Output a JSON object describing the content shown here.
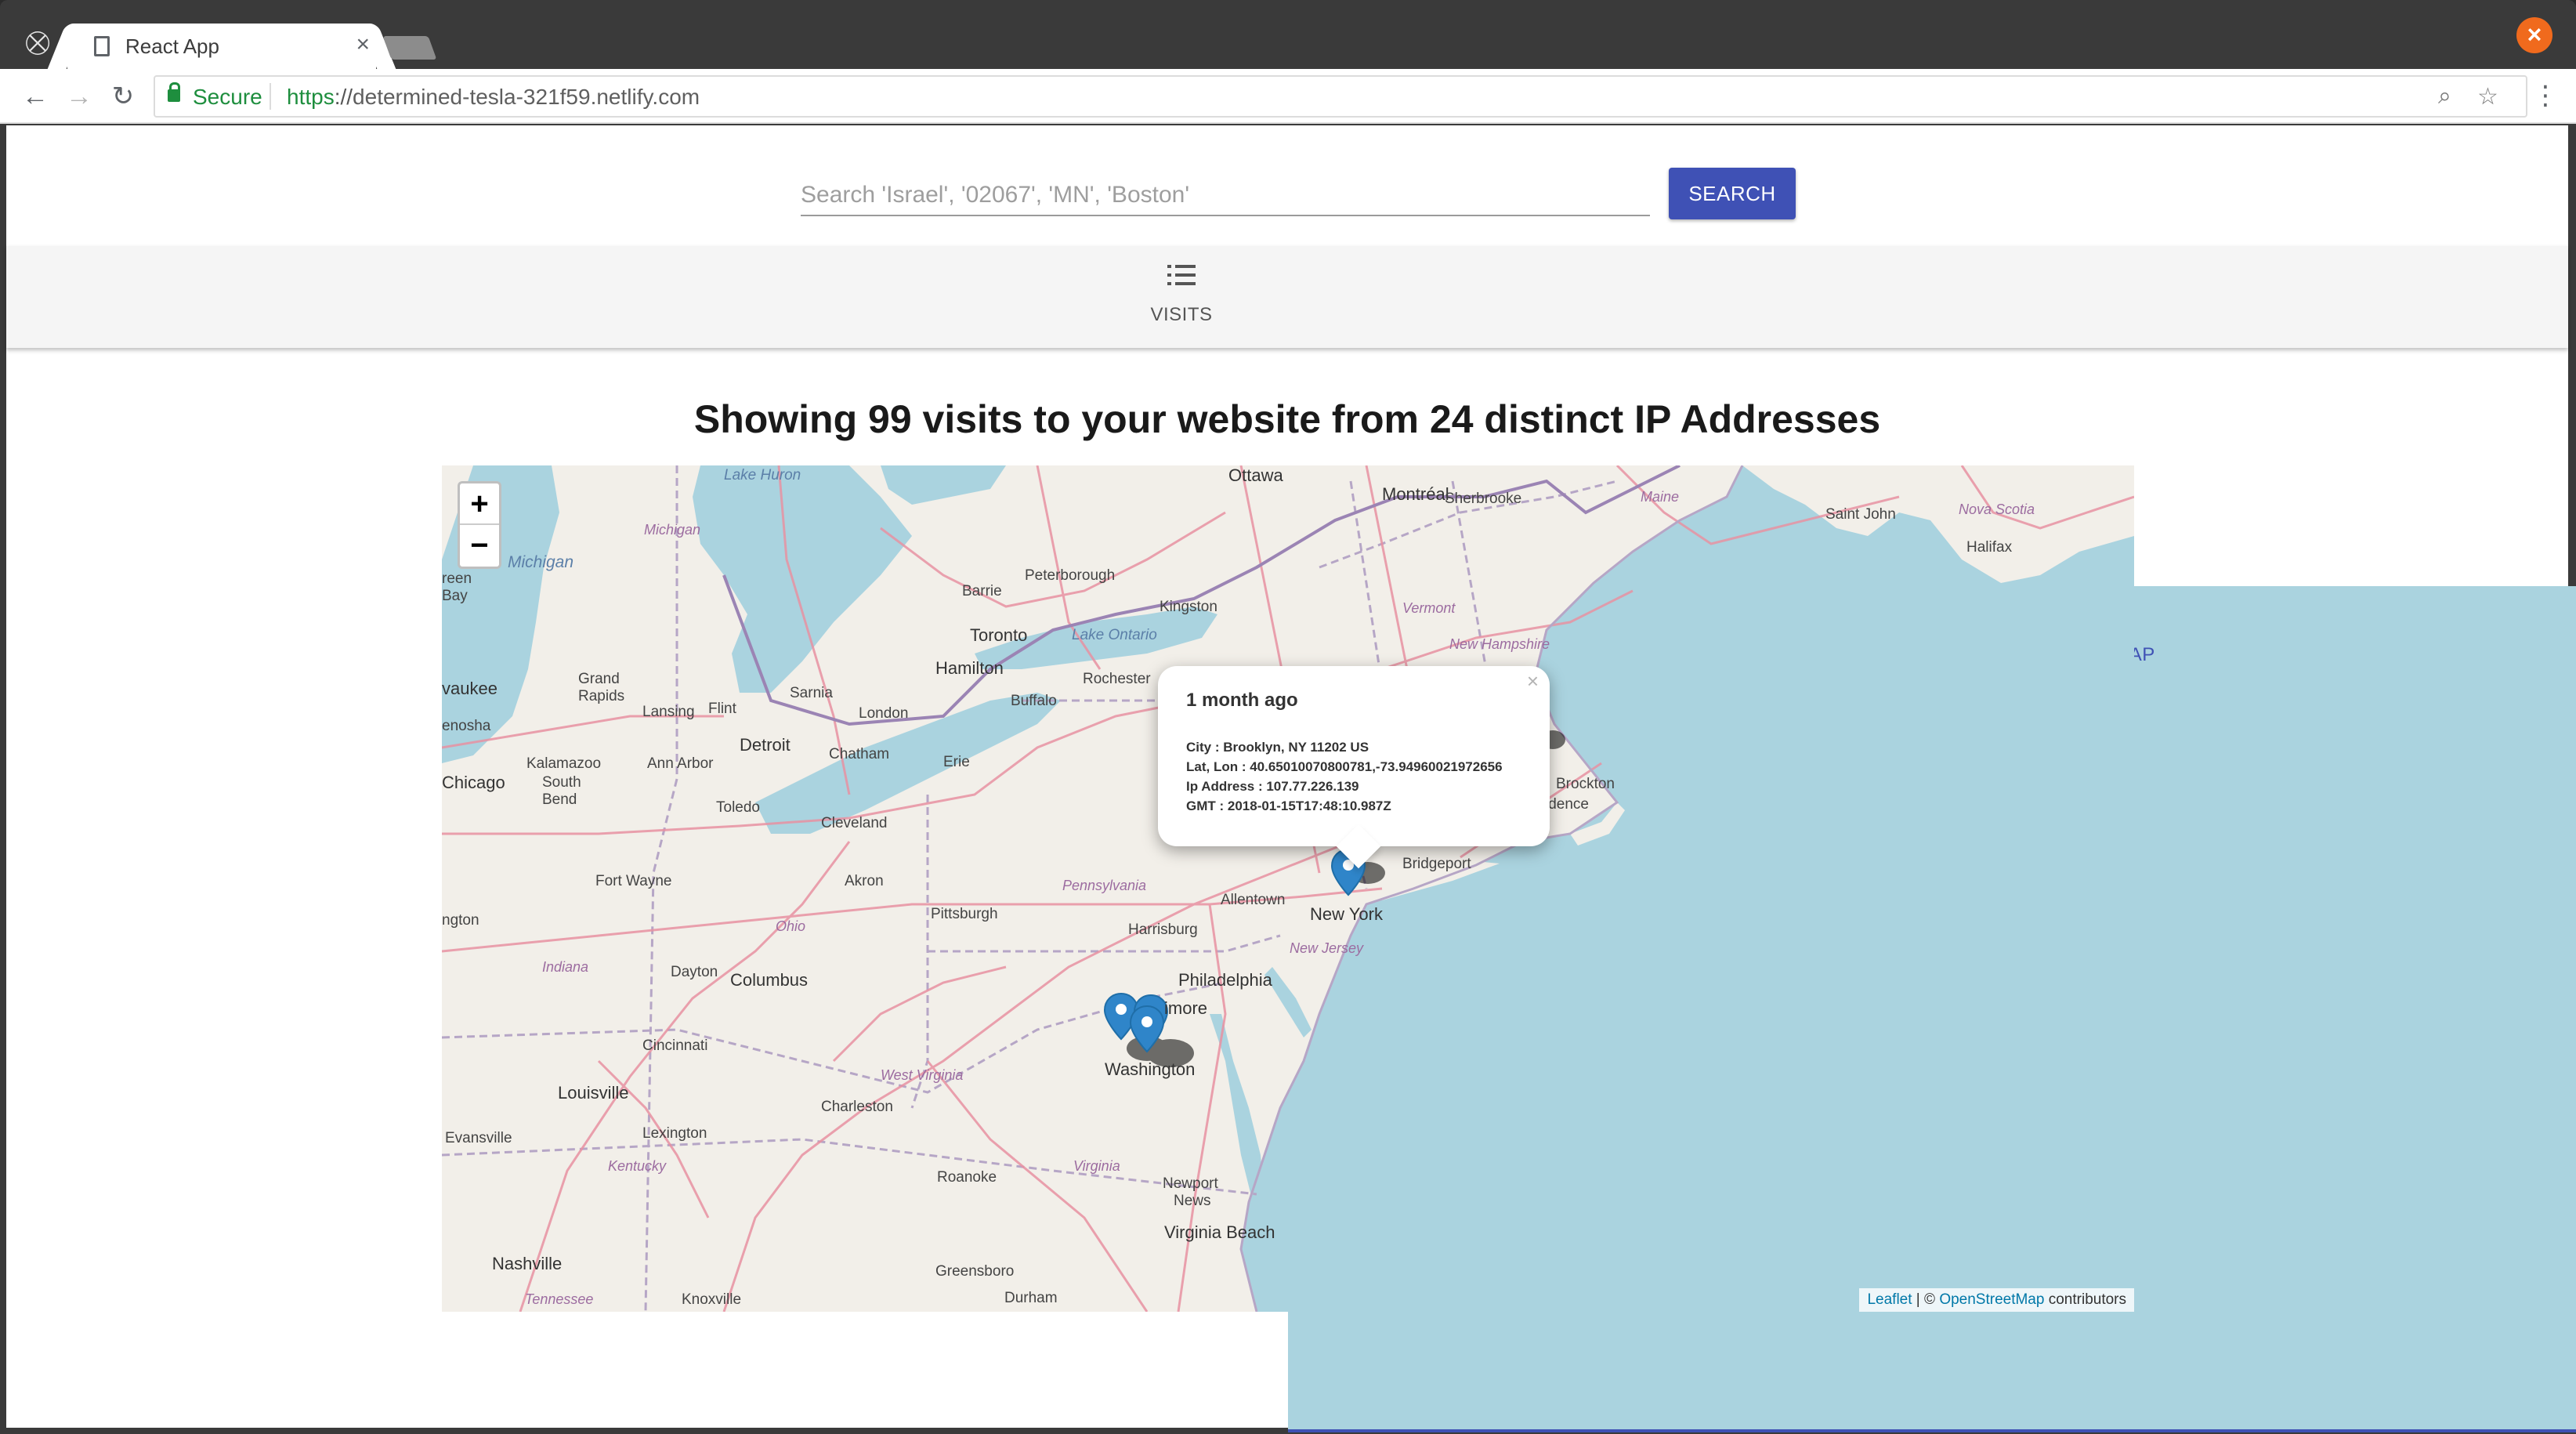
{
  "browser": {
    "tab_title": "React App",
    "tab_close": "×",
    "secure_label": "Secure",
    "url_scheme": "https",
    "url_sep": "://",
    "url_host": "determined-tesla-321f59.netlify.com",
    "window_close": "×"
  },
  "search": {
    "placeholder": "Search 'Israel', '02067', 'MN', 'Boston'",
    "button_label": "SEARCH"
  },
  "tabs": [
    {
      "label": "VISITS",
      "icon": "list-icon",
      "active": false
    },
    {
      "label": "MAP",
      "icon": "map-pin-icon",
      "active": true
    }
  ],
  "heading": "Showing 99 visits to your website from 24 distinct IP Addresses",
  "map": {
    "zoom_in": "+",
    "zoom_out": "−",
    "attribution": {
      "leaflet": "Leaflet",
      "sep": " | © ",
      "osm": "OpenStreetMap",
      "suffix": " contributors"
    },
    "popup": {
      "close": "×",
      "title": "1 month ago",
      "city": "City : Brooklyn, NY 11202 US",
      "latlon": "Lat, Lon : 40.65010070800781,-73.94960021972656",
      "ip": "Ip Address : 107.77.226.139",
      "gmt": "GMT : 2018-01-15T17:48:10.987Z"
    },
    "markers": [
      {
        "place": "Brooklyn"
      },
      {
        "place": "Washington"
      },
      {
        "place": "Washington"
      },
      {
        "place": "Baltimore"
      },
      {
        "place": "Boston"
      }
    ],
    "labels": {
      "lake_huron": "Lake Huron",
      "ottawa": "Ottawa",
      "montreal": "Montréal",
      "sherbrooke": "Sherbrooke",
      "maine": "Maine",
      "saint_john": "Saint John",
      "nova_scotia": "Nova Scotia",
      "halifax": "Halifax",
      "michigan_state": "Michigan",
      "lake_michigan": "Michigan",
      "green_bay": "reen",
      "green_bay2": "Bay",
      "barrie": "Barrie",
      "peterborough": "Peterborough",
      "kingston": "Kingston",
      "vermont": "Vermont",
      "toronto": "Toronto",
      "lake_ontario": "Lake Ontario",
      "new_hampshire": "New Hampshire",
      "milwaukee": "vaukee",
      "grand_rapids": "Grand",
      "grand_rapids2": "Rapids",
      "hamilton": "Hamilton",
      "rochester": "Rochester",
      "sarnia": "Sarnia",
      "lansing": "Lansing",
      "flint": "Flint",
      "buffalo": "Buffalo",
      "kenosha": "enosha",
      "london": "London",
      "detroit": "Detroit",
      "chatham": "Chatham",
      "kalamazoo": "Kalamazoo",
      "ann_arbor": "Ann Arbor",
      "erie": "Erie",
      "chicago": "Chicago",
      "south_bend": "South",
      "south_bend2": "Bend",
      "toledo": "Toledo",
      "cleveland": "Cleveland",
      "brockton": "Brockton",
      "providence": "idence",
      "bridgeport": "Bridgeport",
      "fort_wayne": "Fort Wayne",
      "akron": "Akron",
      "pennsylvania": "Pennsylvania",
      "allentown": "Allentown",
      "new_york": "New York",
      "pittsburgh": "Pittsburgh",
      "lexington_in": "ngton",
      "ohio": "Ohio",
      "harrisburg": "Harrisburg",
      "new_jersey": "New Jersey",
      "indiana": "Indiana",
      "dayton": "Dayton",
      "columbus": "Columbus",
      "philadelphia": "Philadelphia",
      "baltimore": "imore",
      "cincinnati": "Cincinnati",
      "west_virginia": "West Virginia",
      "washington": "Washington",
      "louisville": "Louisville",
      "charleston": "Charleston",
      "evansville": "Evansville",
      "lexington": "Lexington",
      "kentucky": "Kentucky",
      "virginia": "Virginia",
      "roanoke": "Roanoke",
      "newport_news": "Newport",
      "newport_news2": "News",
      "virginia_beach": "Virginia Beach",
      "nashville": "Nashville",
      "greensboro": "Greensboro",
      "tennessee": "Tennessee",
      "knoxville": "Knoxville",
      "durham": "Durham"
    }
  },
  "colors": {
    "accent": "#3f51b5",
    "marker": "#2f85c9",
    "water": "#aad3df",
    "land": "#f2efe9",
    "window_close": "#f06a1d",
    "secure": "#1e8e3e"
  }
}
